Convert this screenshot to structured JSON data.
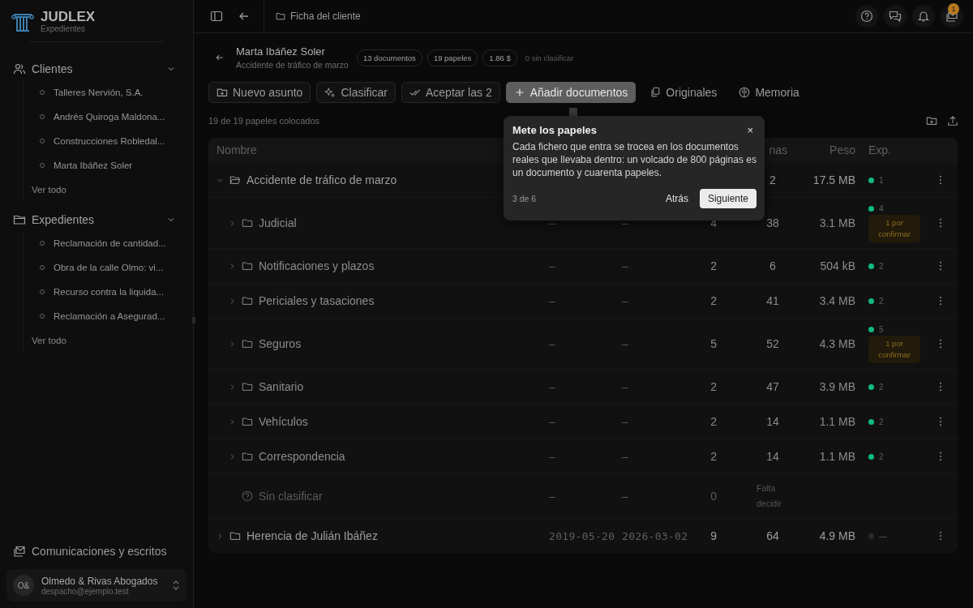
{
  "brand": {
    "name": "JUDLEX",
    "subtitle": "Expedientes"
  },
  "sidebar": {
    "sections": [
      {
        "kind": "clients",
        "label": "Clientes",
        "expanded": true,
        "items": [
          "Talleres Nervión, S.A.",
          "Andrés Quiroga Maldona...",
          "Construcciones Robledal...",
          "Marta Ibáñez Soler"
        ],
        "more": "Ver todo"
      },
      {
        "kind": "cases",
        "label": "Expedientes",
        "expanded": true,
        "items": [
          "Reclamación de cantidad...",
          "Obra de la calle Olmo: vi...",
          "Recurso contra la liquida...",
          "Reclamación a Asegurad..."
        ],
        "more": "Ver todo"
      }
    ],
    "footer_link": "Comunicaciones y escritos",
    "account": {
      "initials": "O&",
      "name": "Olmedo & Rivas Abogados",
      "email": "despacho@ejemplo.test"
    }
  },
  "topbar": {
    "breadcrumb": "Ficha del cliente",
    "notifications_badge": "1"
  },
  "header": {
    "title": "Marta Ibáñez Soler",
    "subtitle": "Accidente de tráfico de marzo",
    "chips": [
      "13 documentos",
      "19 papeles",
      "1.86 $"
    ],
    "unclassified": "0 sin clasificar"
  },
  "toolbar": [
    {
      "kind": "new",
      "label": "Nuevo asunto",
      "outlined": true,
      "highlighted": false
    },
    {
      "kind": "classify",
      "label": "Clasificar",
      "outlined": true,
      "highlighted": false
    },
    {
      "kind": "accept",
      "label": "Aceptar las 2",
      "outlined": true,
      "highlighted": false
    },
    {
      "kind": "add",
      "label": "Añadir documentos",
      "outlined": false,
      "highlighted": true
    },
    {
      "kind": "originals",
      "label": "Originales",
      "outlined": false,
      "highlighted": false
    },
    {
      "kind": "memory",
      "label": "Memoria",
      "outlined": false,
      "highlighted": false
    }
  ],
  "placed_note": "19 de 19 papeles colocados",
  "table": {
    "columns": [
      "Nombre",
      "nas",
      "Peso",
      "Exp."
    ],
    "rows": [
      {
        "kind": "group",
        "name": "Accidente de tráfico de marzo",
        "expanded": true,
        "pages": "2",
        "size": "17.5 MB",
        "exp": {
          "count": "1",
          "color": "#10b981"
        },
        "children": [
          {
            "kind": "folder",
            "name": "Judicial",
            "expanded": false,
            "date_from": "—",
            "date_to": "—",
            "docs": "4",
            "pages": "38",
            "size": "3.1 MB",
            "exp": {
              "count": "4",
              "color": "#10b981"
            },
            "pending": "1 por confirmar"
          },
          {
            "kind": "folder",
            "name": "Notificaciones y plazos",
            "expanded": false,
            "date_from": "—",
            "date_to": "—",
            "docs": "2",
            "pages": "6",
            "size": "504 kB",
            "exp": {
              "count": "2",
              "color": "#10b981"
            }
          },
          {
            "kind": "folder",
            "name": "Periciales y tasaciones",
            "expanded": false,
            "date_from": "—",
            "date_to": "—",
            "docs": "2",
            "pages": "41",
            "size": "3.4 MB",
            "exp": {
              "count": "2",
              "color": "#10b981"
            }
          },
          {
            "kind": "folder",
            "name": "Seguros",
            "expanded": false,
            "date_from": "—",
            "date_to": "—",
            "docs": "5",
            "pages": "52",
            "size": "4.3 MB",
            "exp": {
              "count": "5",
              "color": "#10b981"
            },
            "pending": "1 por confirmar"
          },
          {
            "kind": "folder",
            "name": "Sanitario",
            "expanded": false,
            "date_from": "—",
            "date_to": "—",
            "docs": "2",
            "pages": "47",
            "size": "3.9 MB",
            "exp": {
              "count": "2",
              "color": "#10b981"
            }
          },
          {
            "kind": "folder",
            "name": "Vehículos",
            "expanded": false,
            "date_from": "—",
            "date_to": "—",
            "docs": "2",
            "pages": "14",
            "size": "1.1 MB",
            "exp": {
              "count": "2",
              "color": "#10b981"
            }
          },
          {
            "kind": "folder",
            "name": "Correspondencia",
            "expanded": false,
            "date_from": "—",
            "date_to": "—",
            "docs": "2",
            "pages": "14",
            "size": "1.1 MB",
            "exp": {
              "count": "2",
              "color": "#10b981"
            }
          },
          {
            "kind": "unclassified",
            "name": "Sin clasificar",
            "date_from": "—",
            "date_to": "—",
            "docs": "0",
            "pages": "Falta decidir"
          }
        ]
      },
      {
        "kind": "group",
        "name": "Herencia de Julián Ibáñez",
        "expanded": false,
        "date_from": "2019-05-20",
        "date_to": "2026-03-02",
        "docs": "9",
        "pages": "64",
        "size": "4.9 MB",
        "exp": {
          "count": "—",
          "color": "#2a2a2a"
        }
      }
    ]
  },
  "tour": {
    "title": "Mete los papeles",
    "close": "×",
    "body": "Cada fichero que entra se trocea en los documentos reales que llevaba dentro: un volcado de 800 páginas es un documento y cuarenta papeles.",
    "step": "3 de 6",
    "back": "Atrás",
    "next": "Siguiente"
  }
}
